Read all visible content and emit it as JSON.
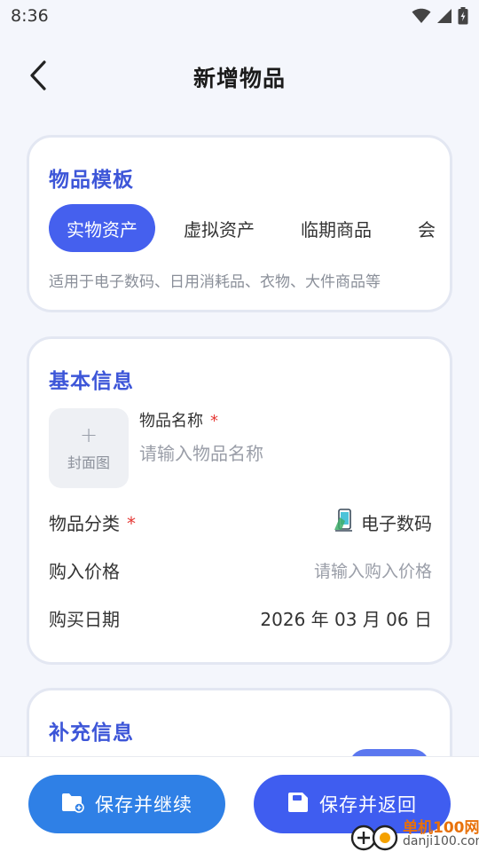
{
  "status_bar": {
    "time": "8:36"
  },
  "header": {
    "title": "新增物品"
  },
  "template_card": {
    "title": "物品模板",
    "tabs": [
      {
        "label": "实物资产",
        "active": true
      },
      {
        "label": "虚拟资产",
        "active": false
      },
      {
        "label": "临期商品",
        "active": false
      },
      {
        "label": "会",
        "active": false
      }
    ],
    "description": "适用于电子数码、日用消耗品、衣物、大件商品等"
  },
  "basic_card": {
    "title": "基本信息",
    "cover": {
      "plus": "+",
      "label": "封面图"
    },
    "name": {
      "label": "物品名称",
      "required_mark": "*",
      "placeholder": "请输入物品名称",
      "value": ""
    },
    "category": {
      "label": "物品分类",
      "required_mark": "*",
      "value": "电子数码",
      "icon": "phone-device-icon"
    },
    "price": {
      "label": "购入价格",
      "placeholder": "请输入购入价格"
    },
    "date": {
      "label": "购买日期",
      "value": "2026 年 03 月 06 日"
    }
  },
  "extra_card": {
    "title": "补充信息"
  },
  "bottom_bar": {
    "save_continue_label": "保存并继续",
    "save_return_label": "保存并返回"
  },
  "watermark": {
    "name_cn": "单机100网",
    "domain": "danji100.com"
  },
  "colors": {
    "accent": "#4560ee",
    "title_blue": "#3d56d8",
    "continue_button": "#2f80e6",
    "return_button": "#3f5df0",
    "required": "#e53935",
    "background": "#f4f6fc"
  }
}
